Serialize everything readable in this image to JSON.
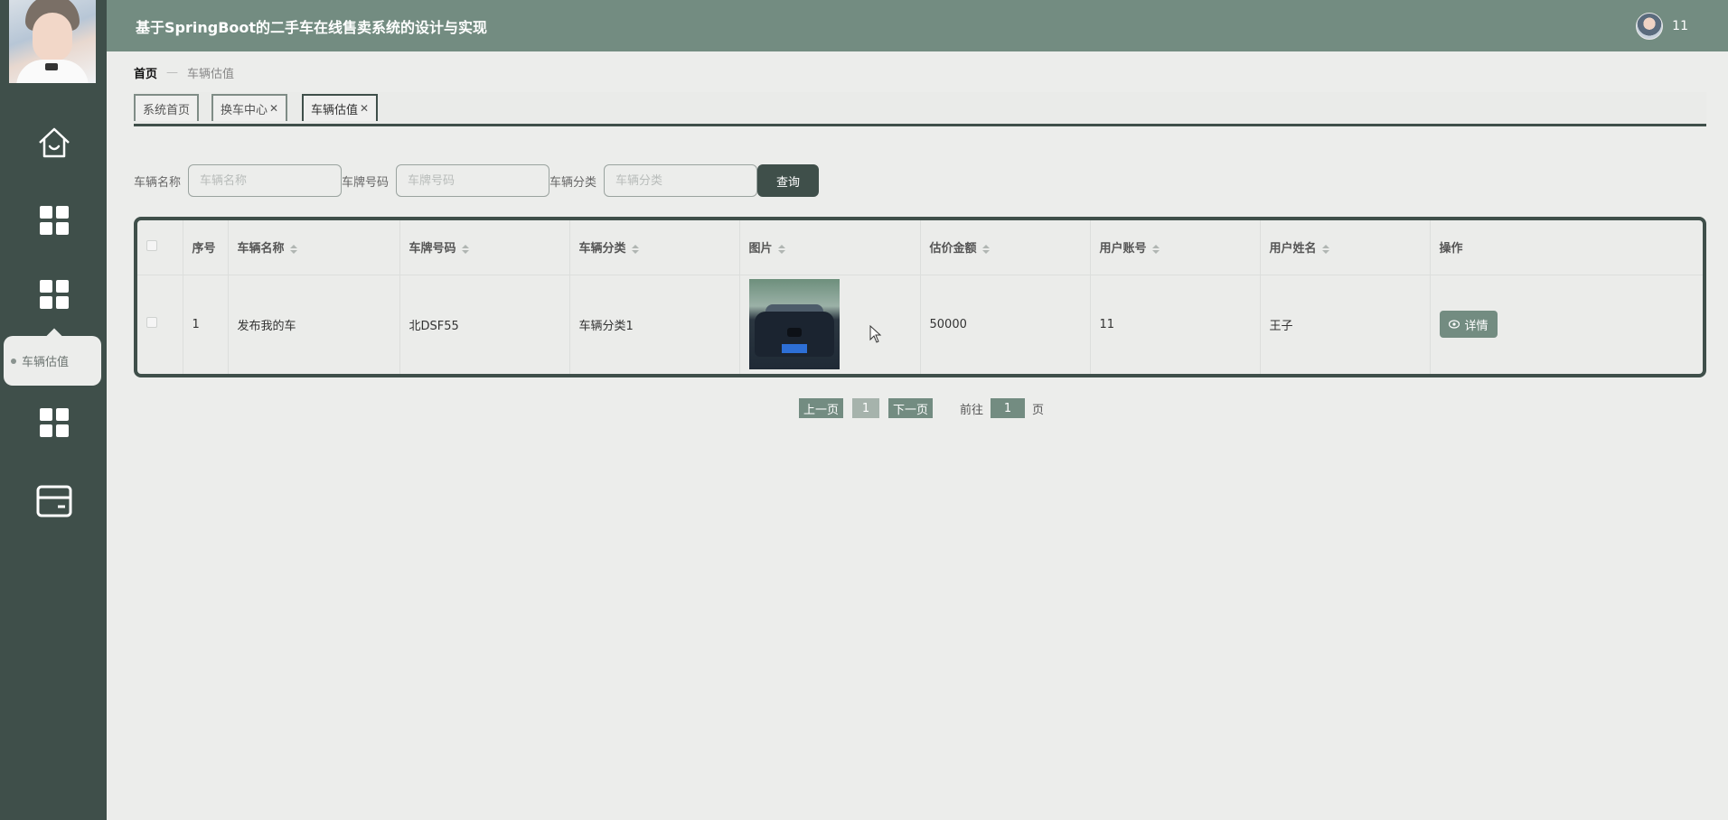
{
  "app": {
    "title": "基于SpringBoot的二手车在线售卖系统的设计与实现"
  },
  "header": {
    "username": "11"
  },
  "sidebar": {
    "items": [
      {
        "icon": "home-icon"
      },
      {
        "icon": "grid-icon"
      },
      {
        "icon": "grid-icon"
      },
      {
        "icon": "grid-icon"
      },
      {
        "icon": "wallet-icon"
      }
    ],
    "popup_label": "车辆估值"
  },
  "breadcrumb": {
    "home": "首页",
    "current": "车辆估值"
  },
  "tabs": [
    {
      "label": "系统首页",
      "closable": false
    },
    {
      "label": "换车中心",
      "closable": true
    },
    {
      "label": "车辆估值",
      "closable": true,
      "active": true
    }
  ],
  "search": {
    "name_label": "车辆名称",
    "name_placeholder": "车辆名称",
    "plate_label": "车牌号码",
    "plate_placeholder": "车牌号码",
    "category_label": "车辆分类",
    "category_placeholder": "车辆分类",
    "query_button": "查询"
  },
  "table": {
    "headers": [
      "序号",
      "车辆名称",
      "车牌号码",
      "车辆分类",
      "图片",
      "估价金额",
      "用户账号",
      "用户姓名",
      "操作"
    ],
    "rows": [
      {
        "index": "1",
        "name": "发布我的车",
        "plate": "北DSF55",
        "category": "车辆分类1",
        "amount": "50000",
        "account": "11",
        "username": "王子",
        "action": "详情"
      }
    ]
  },
  "pagination": {
    "prev": "上一页",
    "current": "1",
    "next": "下一页",
    "goto_label": "前往",
    "goto_value": "1",
    "page_suffix": "页"
  },
  "colors": {
    "sidebar": "#3f4f4a",
    "header": "#738c81",
    "accent": "#738c81",
    "background": "#ecedeb"
  }
}
